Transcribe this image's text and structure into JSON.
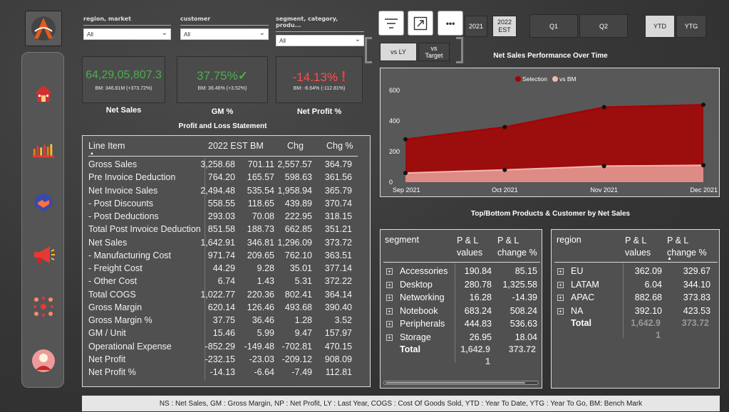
{
  "filters": [
    {
      "label": "region, market",
      "value": "All"
    },
    {
      "label": "customer",
      "value": "All"
    },
    {
      "label": "segment, category, produ...",
      "value": "All"
    }
  ],
  "toolbar": {
    "more_label": "•••",
    "year_2021": "2021",
    "year_2022_line1": "2022",
    "year_2022_line2": "EST",
    "q1": "Q1",
    "q2": "Q2",
    "ytd": "YTD",
    "ytg": "YTG",
    "vs_ly": "vs LY",
    "vs_target_line1": "vs",
    "vs_target_line2": "Target"
  },
  "kpis": [
    {
      "value": "64,29,05,807.3",
      "sub": "BM: 346.81M (+373.72%)",
      "label": "Net Sales",
      "color": "#4caf50"
    },
    {
      "value": "37.75%",
      "sub": "BM: 36.46% (+3.52%)",
      "label": "GM %",
      "color": "#4caf50"
    },
    {
      "value": "-14.13%",
      "sub": "BM: -6.64% (-112.81%)",
      "label": "Net Profit %",
      "color": "#ff4d4d"
    }
  ],
  "pl": {
    "title": "Profit and Loss Statement",
    "headers": [
      "Line Item",
      "2022 EST",
      "BM",
      "Chg",
      "Chg %"
    ],
    "rows": [
      [
        "Gross Sales",
        "3,258.68",
        "701.11",
        "2,557.57",
        "364.79"
      ],
      [
        "Pre Invoice Deduction",
        "764.20",
        "165.57",
        "598.63",
        "361.56"
      ],
      [
        "Net Invoice Sales",
        "2,494.48",
        "535.54",
        "1,958.94",
        "365.79"
      ],
      [
        "- Post Discounts",
        "558.55",
        "118.65",
        "439.89",
        "370.74"
      ],
      [
        "- Post Deductions",
        "293.03",
        "70.08",
        "222.95",
        "318.15"
      ],
      [
        "Total Post Invoice Deduction",
        "851.58",
        "188.73",
        "662.85",
        "351.21"
      ],
      [
        "Net Sales",
        "1,642.91",
        "346.81",
        "1,296.09",
        "373.72"
      ],
      [
        "- Manufacturing Cost",
        "971.74",
        "209.65",
        "762.10",
        "363.51"
      ],
      [
        "- Freight Cost",
        "44.29",
        "9.28",
        "35.01",
        "377.14"
      ],
      [
        "- Other Cost",
        "6.74",
        "1.43",
        "5.31",
        "372.22"
      ],
      [
        "Total COGS",
        "1,022.77",
        "220.36",
        "802.41",
        "364.14"
      ],
      [
        "Gross Margin",
        "620.14",
        "126.46",
        "493.68",
        "390.40"
      ],
      [
        "Gross Margin %",
        "37.75",
        "36.46",
        "1.28",
        "3.52"
      ],
      [
        "GM / Unit",
        "15.46",
        "5.99",
        "9.47",
        "157.97"
      ],
      [
        "Operational Expense",
        "-852.29",
        "-149.48",
        "-702.81",
        "470.15"
      ],
      [
        "Net Profit",
        "-232.15",
        "-23.03",
        "-209.12",
        "908.09"
      ],
      [
        "Net Profit %",
        "-14.13",
        "-6.64",
        "-7.49",
        "112.81"
      ]
    ]
  },
  "chart_title": "Net Sales Performance Over Time",
  "chart_data": {
    "type": "area",
    "categories": [
      "Sep 2021",
      "Oct 2021",
      "Nov 2021",
      "Dec 2021"
    ],
    "series": [
      {
        "name": "Selection",
        "values": [
          280,
          360,
          490,
          505
        ],
        "color": "#a80000"
      },
      {
        "name": "vs BM",
        "values": [
          60,
          80,
          105,
          110
        ],
        "color": "#f4b6ae"
      }
    ],
    "yticks": [
      "0",
      "200",
      "400",
      "600"
    ],
    "ylim": [
      0,
      650
    ],
    "legend_position": "top-center"
  },
  "topbottom_title": "Top/Bottom Products & Customer by Net Sales",
  "segment_table": {
    "headers": [
      "segment",
      "P & L",
      "values",
      "P & L",
      "change %"
    ],
    "rows": [
      [
        "Accessories",
        "190.84",
        "85.15"
      ],
      [
        "Desktop",
        "280.78",
        "1,325.58"
      ],
      [
        "Networking",
        "16.28",
        "-14.39"
      ],
      [
        "Notebook",
        "683.24",
        "508.24"
      ],
      [
        "Peripherals",
        "444.83",
        "536.63"
      ],
      [
        "Storage",
        "26.95",
        "18.04"
      ]
    ],
    "total_label": "Total",
    "total_value": "1,642.9",
    "total_value_wrap": "1",
    "total_change": "373.72"
  },
  "region_table": {
    "headers": [
      "region",
      "P & L",
      "values",
      "P & L",
      "change %"
    ],
    "rows": [
      [
        "EU",
        "362.09",
        "329.67"
      ],
      [
        "LATAM",
        "6.04",
        "344.10"
      ],
      [
        "APAC",
        "882.68",
        "373.83"
      ],
      [
        "NA",
        "392.10",
        "423.53"
      ]
    ],
    "total_label": "Total",
    "total_value": "1,642.9",
    "total_value_wrap": "1",
    "total_change": "373.72"
  },
  "footer_text": "NS : Net Sales, GM : Gross Margin, NP : Net Profit, LY : Last Year, COGS : Cost Of Goods Sold, YTD : Year To Date, YTG : Year To Go, BM: Bench Mark"
}
